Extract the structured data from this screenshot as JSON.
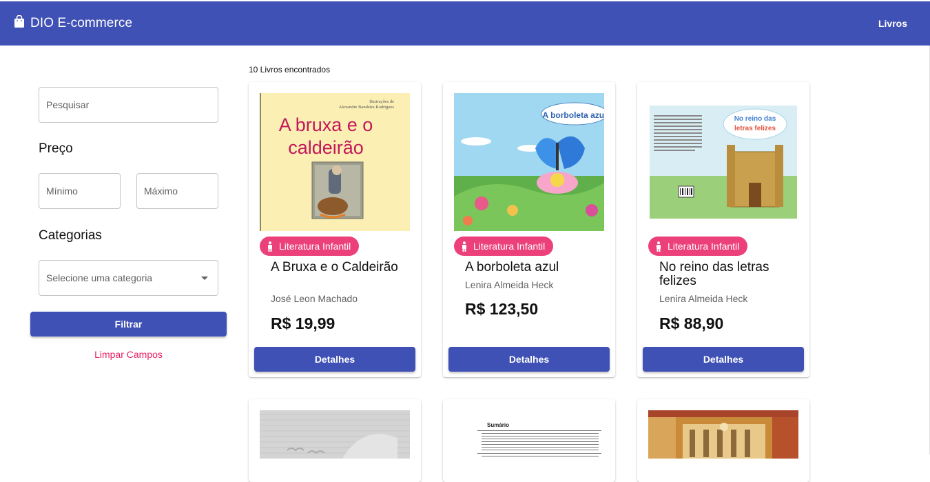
{
  "header": {
    "brand_title": "DIO E-commerce",
    "nav_link": "Livros",
    "color": "#3f51b5"
  },
  "filters": {
    "search_placeholder": "Pesquisar",
    "price_title": "Preço",
    "min_placeholder": "Mínimo",
    "max_placeholder": "Máximo",
    "categories_title": "Categorias",
    "category_selected": "Selecione uma categoria",
    "filter_button": "Filtrar",
    "clear_link": "Limpar Campos"
  },
  "results": {
    "count_text": "10 Livros encontrados"
  },
  "books": [
    {
      "title": "A Bruxa e o Caldeirão",
      "author": "José Leon Machado",
      "price": "R$ 19,99",
      "category": "Literatura Infantil",
      "details_label": "Detalhes",
      "cover_title": "A bruxa e o caldeirão",
      "cover_credit_1": "Ilustrações de",
      "cover_credit_2": "Alexandre Bandeira Rodrigues"
    },
    {
      "title": "A borboleta azul",
      "author": "Lenira Almeida Heck",
      "price": "R$ 123,50",
      "category": "Literatura Infantil",
      "details_label": "Detalhes",
      "cover_title": "A borboleta azul"
    },
    {
      "title": "No reino das letras felizes",
      "author": "Lenira Almeida Heck",
      "price": "R$ 88,90",
      "category": "Literatura Infantil",
      "details_label": "Detalhes",
      "cover_title_1": "No reino das",
      "cover_title_2": "letras felizes"
    }
  ],
  "partial_books": [
    {
      "cover_text": ""
    },
    {
      "cover_text": "Sumário"
    },
    {
      "cover_text": ""
    }
  ],
  "colors": {
    "primary": "#3f51b5",
    "chip": "#ec407a",
    "link": "#e91e63"
  }
}
